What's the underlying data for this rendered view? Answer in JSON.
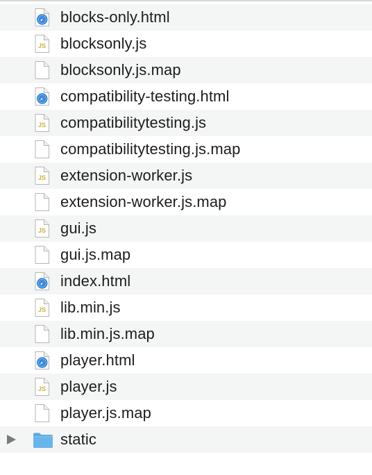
{
  "files": [
    {
      "name": "blocks-only.html",
      "icon": "safari-html-document-icon"
    },
    {
      "name": "blocksonly.js",
      "icon": "javascript-document-icon"
    },
    {
      "name": "blocksonly.js.map",
      "icon": "blank-document-icon"
    },
    {
      "name": "compatibility-testing.html",
      "icon": "safari-html-document-icon"
    },
    {
      "name": "compatibilitytesting.js",
      "icon": "javascript-document-icon"
    },
    {
      "name": "compatibilitytesting.js.map",
      "icon": "blank-document-icon"
    },
    {
      "name": "extension-worker.js",
      "icon": "javascript-document-icon"
    },
    {
      "name": "extension-worker.js.map",
      "icon": "blank-document-icon"
    },
    {
      "name": "gui.js",
      "icon": "javascript-document-icon"
    },
    {
      "name": "gui.js.map",
      "icon": "blank-document-icon"
    },
    {
      "name": "index.html",
      "icon": "safari-html-document-icon"
    },
    {
      "name": "lib.min.js",
      "icon": "javascript-document-icon"
    },
    {
      "name": "lib.min.js.map",
      "icon": "blank-document-icon"
    },
    {
      "name": "player.html",
      "icon": "safari-html-document-icon"
    },
    {
      "name": "player.js",
      "icon": "javascript-document-icon"
    },
    {
      "name": "player.js.map",
      "icon": "blank-document-icon"
    }
  ],
  "folder": {
    "name": "static",
    "icon": "folder-icon",
    "expander_icon": "disclosure-triangle-icon"
  },
  "js_badge_text": "JS",
  "colors": {
    "stripe": "#f4f5f5",
    "folder": "#69b4ea",
    "safari_blue": "#2f8ce8",
    "js_badge": "#c7b33e"
  }
}
